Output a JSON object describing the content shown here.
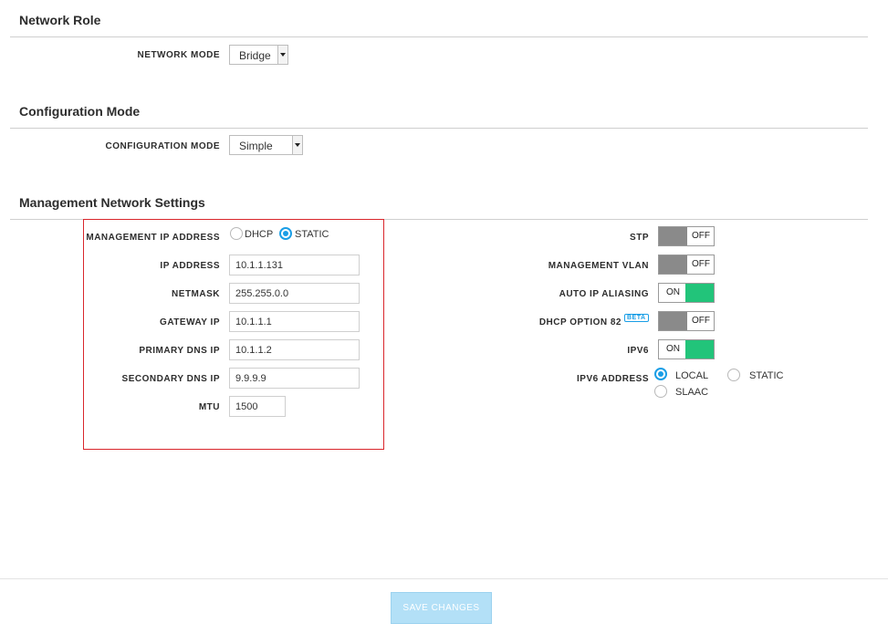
{
  "network_role": {
    "title": "Network Role",
    "network_mode_label": "NETWORK MODE",
    "network_mode_value": "Bridge"
  },
  "configuration_mode": {
    "title": "Configuration Mode",
    "label": "CONFIGURATION MODE",
    "value": "Simple"
  },
  "management": {
    "title": "Management Network Settings",
    "ip_address_mode_label": "MANAGEMENT IP ADDRESS",
    "dhcp_label": "DHCP",
    "static_label": "STATIC",
    "selected_mode": "STATIC",
    "fields": {
      "ip_address": {
        "label": "IP ADDRESS",
        "value": "10.1.1.131"
      },
      "netmask": {
        "label": "NETMASK",
        "value": "255.255.0.0"
      },
      "gateway_ip": {
        "label": "GATEWAY IP",
        "value": "10.1.1.1"
      },
      "primary_dns": {
        "label": "PRIMARY DNS IP",
        "value": "10.1.1.2"
      },
      "secondary_dns": {
        "label": "SECONDARY DNS IP",
        "value": "9.9.9.9"
      },
      "mtu": {
        "label": "MTU",
        "value": "1500"
      }
    }
  },
  "toggles": {
    "stp": {
      "label": "STP",
      "state": "OFF"
    },
    "management_vlan": {
      "label": "MANAGEMENT VLAN",
      "state": "OFF"
    },
    "auto_ip_aliasing": {
      "label": "AUTO IP ALIASING",
      "state": "ON"
    },
    "dhcp_option_82": {
      "label": "DHCP OPTION 82",
      "badge": "BETA",
      "state": "OFF"
    },
    "ipv6": {
      "label": "IPV6",
      "state": "ON"
    }
  },
  "ipv6_address": {
    "label": "IPV6 ADDRESS",
    "options": {
      "local": "LOCAL",
      "static": "STATIC",
      "slaac": "SLAAC"
    },
    "selected": "LOCAL"
  },
  "footer": {
    "save_label": "SAVE CHANGES"
  },
  "colors": {
    "accent": "#1a9ee6",
    "toggle_on": "#22c47a",
    "toggle_off": "#8a8a8a",
    "highlight": "#d9262c",
    "save_button": "#b3e0f7"
  }
}
